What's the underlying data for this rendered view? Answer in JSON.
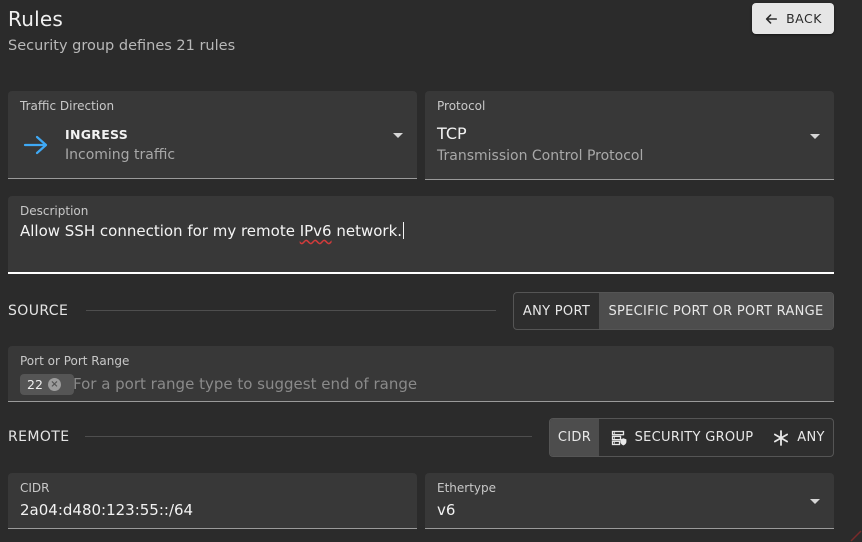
{
  "header": {
    "title": "Rules",
    "subtitle": "Security group defines 21 rules",
    "back_label": "BACK"
  },
  "traffic_direction": {
    "label": "Traffic Direction",
    "value": "INGRESS",
    "description": "Incoming traffic",
    "icon": "arrow-right-icon",
    "icon_color": "#3fa9f5"
  },
  "protocol": {
    "label": "Protocol",
    "value": "TCP",
    "description": "Transmission Control Protocol"
  },
  "description": {
    "label": "Description",
    "text_before": "Allow SSH connection for my remote ",
    "text_misspelled": "IPv6",
    "text_after": " network."
  },
  "source": {
    "label": "SOURCE",
    "options": [
      "ANY PORT",
      "SPECIFIC PORT OR PORT RANGE"
    ],
    "selected": "SPECIFIC PORT OR PORT RANGE"
  },
  "port": {
    "label": "Port or Port Range",
    "chips": [
      "22"
    ],
    "placeholder": "For a port range type to suggest end of range"
  },
  "remote": {
    "label": "REMOTE",
    "options": [
      {
        "label": "CIDR",
        "icon": ""
      },
      {
        "label": "SECURITY GROUP",
        "icon": "server-shield-icon"
      },
      {
        "label": "ANY",
        "icon": "asterisk-icon"
      }
    ],
    "selected": "CIDR"
  },
  "cidr": {
    "label": "CIDR",
    "value": "2a04:d480:123:55::/64"
  },
  "ethertype": {
    "label": "Ethertype",
    "value": "v6"
  },
  "colors": {
    "background": "#2b2b2b",
    "field": "#383838",
    "accent": "#3fa9f5",
    "toggle_active": "#4d4d4d"
  }
}
